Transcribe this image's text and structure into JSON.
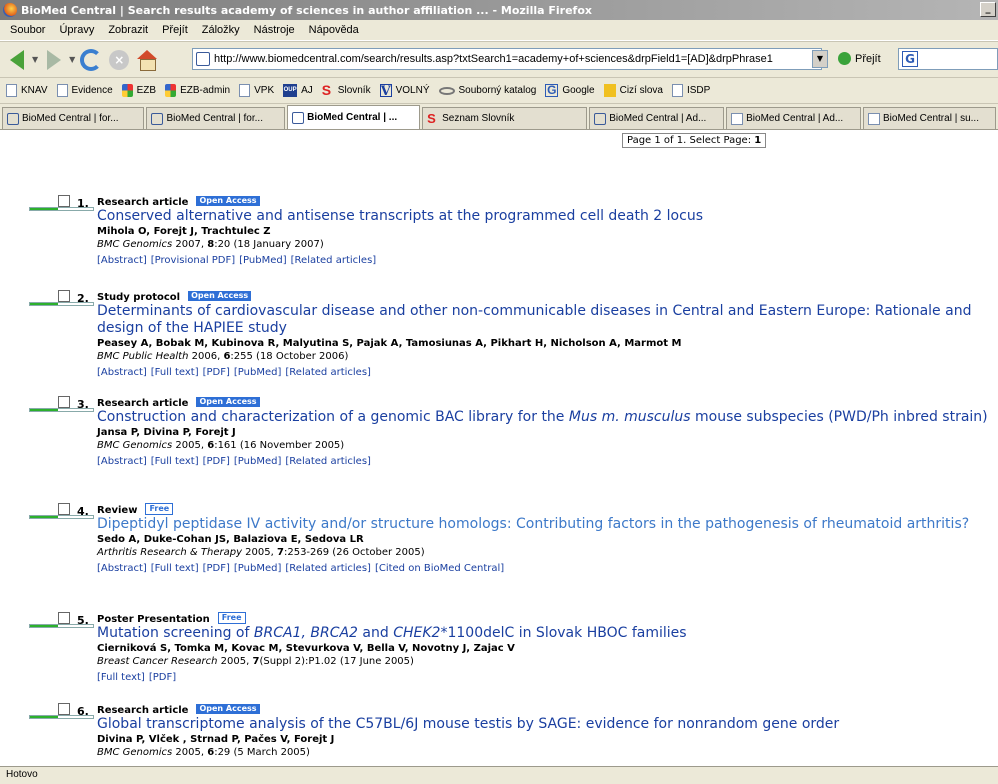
{
  "window": {
    "title": "BioMed Central | Search results academy of sciences in author affiliation ... - Mozilla Firefox",
    "min_label": "_"
  },
  "menu": [
    "Soubor",
    "Úpravy",
    "Zobrazit",
    "Přejít",
    "Záložky",
    "Nástroje",
    "Nápověda"
  ],
  "nav": {
    "url": "http://www.biomedcentral.com/search/results.asp?txtSearch1=academy+of+sciences&drpField1=[AD]&drpPhrase1",
    "go_label": "Přejít",
    "search_logo": "G"
  },
  "bookmarks": [
    {
      "label": "KNAV",
      "icon": "page"
    },
    {
      "label": "Evidence",
      "icon": "page"
    },
    {
      "label": "EZB",
      "icon": "ezb"
    },
    {
      "label": "EZB-admin",
      "icon": "ezb"
    },
    {
      "label": "VPK",
      "icon": "page"
    },
    {
      "label": "AJ",
      "icon": "oup",
      "icon_text": "OUP"
    },
    {
      "label": "Slovník",
      "icon": "s-red",
      "icon_text": "S"
    },
    {
      "label": "VOLNÝ",
      "icon": "v",
      "icon_text": "V"
    },
    {
      "label": "Souborný katalog",
      "icon": "katalog"
    },
    {
      "label": "Google",
      "icon": "g",
      "icon_text": "G"
    },
    {
      "label": "Cizí slova",
      "icon": "cizi"
    },
    {
      "label": "ISDP",
      "icon": "page"
    }
  ],
  "tabs": [
    {
      "label": "BioMed Central | for...",
      "icon": "bmc"
    },
    {
      "label": "BioMed Central | for...",
      "icon": "bmc"
    },
    {
      "label": "BioMed Central | ...",
      "icon": "bmc",
      "active": true
    },
    {
      "label": "Seznam Slovník",
      "icon": "s"
    },
    {
      "label": "BioMed Central | Ad...",
      "icon": "bmc"
    },
    {
      "label": "BioMed Central | Ad...",
      "icon": "pg"
    },
    {
      "label": "BioMed Central | su...",
      "icon": "pg"
    }
  ],
  "page_selector": {
    "text": "Page 1 of 1. Select Page:",
    "current": "1"
  },
  "results": [
    {
      "num": "1.",
      "type": "Research article",
      "badge": "Open Access",
      "badge_style": "oa",
      "title": "Conserved alternative and antisense transcripts at the programmed cell death 2 locus",
      "authors": "Mihola O, Forejt J, Trachtulec Z",
      "journal": "BMC Genomics",
      "year_rest": " 2007, ",
      "vol": "8",
      "cite_rest": ":20 (18 January 2007)",
      "links": [
        "[Abstract]",
        "[Provisional PDF]",
        "[PubMed]",
        "[Related articles]"
      ],
      "relevance": 0.45
    },
    {
      "num": "2.",
      "type": "Study protocol",
      "badge": "Open Access",
      "badge_style": "oa",
      "title": "Determinants of cardiovascular disease and other non-communicable diseases in Central and Eastern Europe: Rationale and design of the HAPIEE study",
      "authors": "Peasey A, Bobak M, Kubinova R, Malyutina S, Pajak A, Tamosiunas A, Pikhart H, Nicholson A, Marmot M",
      "journal": "BMC Public Health",
      "year_rest": " 2006, ",
      "vol": "6",
      "cite_rest": ":255 (18 October 2006)",
      "links": [
        "[Abstract]",
        "[Full text]",
        "[PDF]",
        "[PubMed]",
        "[Related articles]"
      ],
      "relevance": 0.45
    },
    {
      "num": "3.",
      "type": "Research article",
      "badge": "Open Access",
      "badge_style": "oa",
      "title_parts": [
        "Construction and characterization of a genomic BAC library for the ",
        "Mus m. musculus",
        " mouse subspecies (PWD/Ph inbred strain)"
      ],
      "authors": "Jansa P, Divina P, Forejt J",
      "journal": "BMC Genomics",
      "year_rest": " 2005, ",
      "vol": "6",
      "cite_rest": ":161 (16 November 2005)",
      "links": [
        "[Abstract]",
        "[Full text]",
        "[PDF]",
        "[PubMed]",
        "[Related articles]"
      ],
      "relevance": 0.45
    },
    {
      "num": "4.",
      "type": "Review",
      "badge": "Free",
      "badge_style": "free",
      "title": "Dipeptidyl peptidase IV activity and/or structure homologs: Contributing factors in the pathogenesis of rheumatoid arthritis?",
      "authors": "Sedo A, Duke-Cohan JS, Balaziova E, Sedova LR",
      "journal": "Arthritis Research & Therapy",
      "year_rest": " 2005, ",
      "vol": "7",
      "cite_rest": ":253-269 (26 October 2005)",
      "links": [
        "[Abstract]",
        "[Full text]",
        "[PDF]",
        "[PubMed]",
        "[Related articles]",
        "[Cited on BioMed Central]"
      ],
      "relevance": 0.45
    },
    {
      "num": "5.",
      "type": "Poster Presentation",
      "badge": "Free",
      "badge_style": "free",
      "title_parts": [
        "Mutation screening of ",
        "BRCA1, BRCA2",
        " and ",
        "CHEK2",
        "*1100delC in Slovak HBOC families"
      ],
      "authors": "Cierniková S, Tomka M, Kovac M, Stevurkova V, Bella V, Novotny J, Zajac V",
      "journal": "Breast Cancer Research",
      "year_rest": " 2005, ",
      "vol": "7",
      "cite_rest": "(Suppl 2):P1.02 (17 June 2005)",
      "links": [
        "[Full text]",
        "[PDF]"
      ],
      "relevance": 0.45
    },
    {
      "num": "6.",
      "type": "Research article",
      "badge": "Open Access",
      "badge_style": "oa",
      "title": "Global transcriptome analysis of the C57BL/6J mouse testis by SAGE: evidence for nonrandom gene order",
      "authors": "Divina P, Vlček , Strnad P, Pačes V, Forejt J",
      "journal": "BMC Genomics",
      "year_rest": " 2005, ",
      "vol": "6",
      "cite_rest": ":29 (5 March 2005)",
      "links": [],
      "relevance": 0.45
    }
  ],
  "status": "Hotovo"
}
